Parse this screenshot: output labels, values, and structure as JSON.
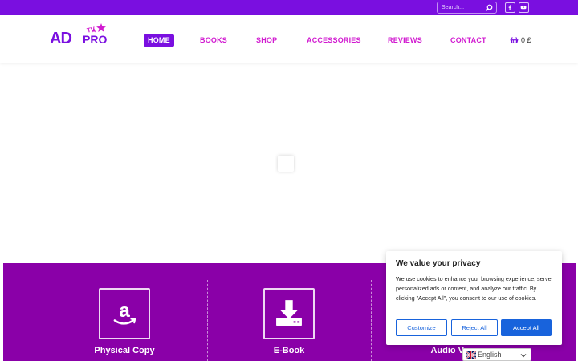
{
  "topbar": {
    "search_placeholder": "Search...",
    "social": [
      {
        "name": "facebook",
        "icon": "facebook-icon"
      },
      {
        "name": "youtube",
        "icon": "youtube-icon"
      }
    ],
    "bg_color": "#7a0fe0"
  },
  "header": {
    "logo": {
      "text": "ADPRO",
      "badge": "TV"
    },
    "nav": [
      {
        "label": "HOME",
        "active": true
      },
      {
        "label": "BOOKS",
        "active": false
      },
      {
        "label": "SHOP",
        "active": false
      },
      {
        "label": "ACCESSORIES",
        "active": false
      },
      {
        "label": "REVIEWS",
        "active": false
      },
      {
        "label": "CONTACT",
        "active": false
      }
    ],
    "cart": {
      "icon": "basket-icon",
      "count": "0",
      "currency": "£",
      "text": "0 £"
    },
    "nav_color": "#d11ad0"
  },
  "features": {
    "items": [
      {
        "label": "Physical Copy",
        "icon": "amazon-icon"
      },
      {
        "label": "E-Book",
        "icon": "download-icon"
      },
      {
        "label": "Audio Ve",
        "icon": "audio-icon"
      }
    ],
    "bg_color": "#8a00a8"
  },
  "cookie_banner": {
    "title": "We value your privacy",
    "text": "We use cookies to enhance your browsing experience, serve personalized ads or content, and analyze our traffic. By clicking \"Accept All\", you consent to our use of cookies.",
    "buttons": {
      "customize": "Customize",
      "reject": "Reject All",
      "accept": "Accept All"
    },
    "accent_color": "#1863dc"
  },
  "language": {
    "label": "English",
    "flag_icon": "uk-flag-icon"
  }
}
